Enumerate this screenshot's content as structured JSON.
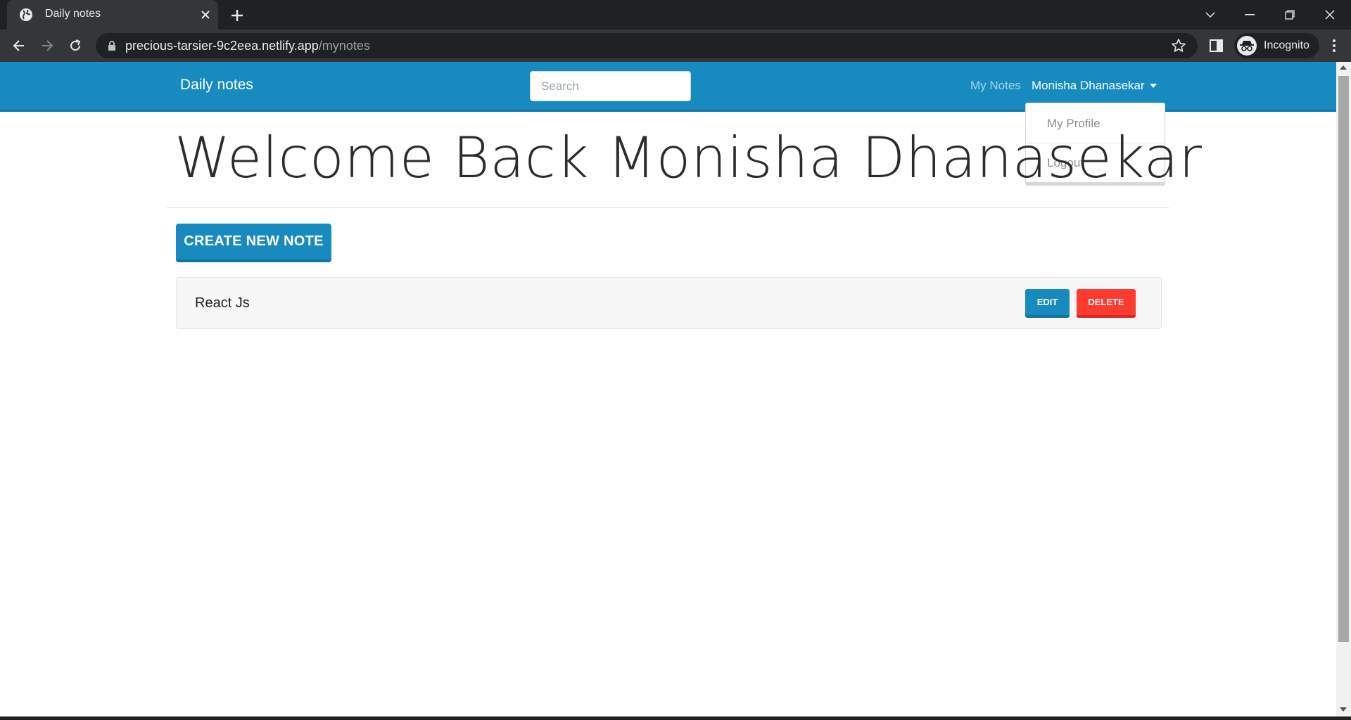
{
  "browser": {
    "tab_title": "Daily notes",
    "url_host": "precious-tarsier-9c2eea.netlify.app",
    "url_path": "/mynotes",
    "profile_label": "Incognito"
  },
  "navbar": {
    "brand": "Daily notes",
    "search_placeholder": "Search",
    "my_notes_link": "My Notes",
    "user_name": "Monisha Dhanasekar"
  },
  "user_menu": {
    "items": [
      "My Profile",
      "Logout"
    ]
  },
  "main": {
    "welcome_title": "Welcome Back Monisha Dhanasekar",
    "create_button": "CREATE NEW NOTE",
    "notes": [
      {
        "title": "React Js",
        "edit_label": "EDIT",
        "delete_label": "DELETE"
      }
    ]
  },
  "colors": {
    "primary": "#178bbf",
    "danger": "#ff3b2f"
  }
}
